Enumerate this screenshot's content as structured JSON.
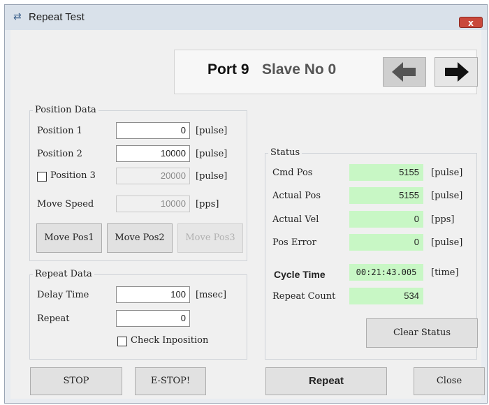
{
  "window": {
    "title": "Repeat Test",
    "close_label": "x"
  },
  "port": {
    "port_text": "Port 9",
    "slave_text": "Slave No 0"
  },
  "position_data": {
    "title": "Position Data",
    "pos1_label": "Position 1",
    "pos1_value": "0",
    "pos1_unit": "[pulse]",
    "pos2_label": "Position 2",
    "pos2_value": "10000",
    "pos2_unit": "[pulse]",
    "pos3_label": "Position 3",
    "pos3_value": "20000",
    "pos3_unit": "[pulse]",
    "speed_label": "Move Speed",
    "speed_value": "10000",
    "speed_unit": "[pps]",
    "move1": "Move Pos1",
    "move2": "Move Pos2",
    "move3": "Move Pos3"
  },
  "repeat_data": {
    "title": "Repeat Data",
    "delay_label": "Delay Time",
    "delay_value": "100",
    "delay_unit": "[msec]",
    "repeat_label": "Repeat",
    "repeat_value": "0",
    "check_label": "Check Inposition"
  },
  "status": {
    "title": "Status",
    "cmd_label": "Cmd Pos",
    "cmd_value": "5155",
    "cmd_unit": "[pulse]",
    "act_label": "Actual Pos",
    "act_value": "5155",
    "act_unit": "[pulse]",
    "vel_label": "Actual Vel",
    "vel_value": "0",
    "vel_unit": "[pps]",
    "err_label": "Pos Error",
    "err_value": "0",
    "err_unit": "[pulse]",
    "cycle_label": "Cycle Time",
    "cycle_value": "00:21:43.005",
    "cycle_unit": "[time]",
    "count_label": "Repeat Count",
    "count_value": "534",
    "clear_label": "Clear Status"
  },
  "bottom": {
    "stop": "STOP",
    "estop": "E-STOP!",
    "repeat": "Repeat",
    "close": "Close"
  },
  "colors": {
    "status_green": "#c8f7c5",
    "close_red": "#c9483b"
  },
  "icons": [
    "repeat-icon",
    "arrow-left-icon",
    "arrow-right-icon"
  ]
}
